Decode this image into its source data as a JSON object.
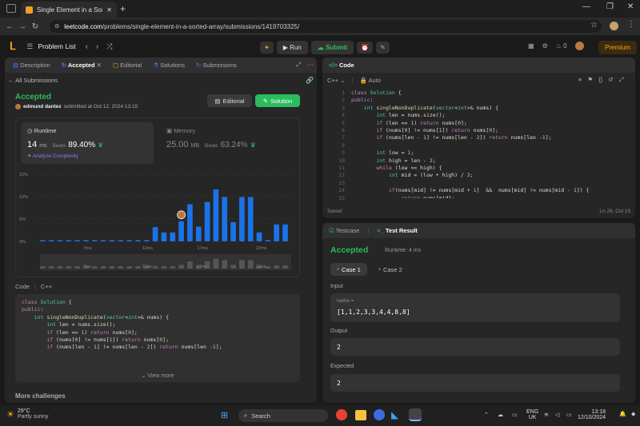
{
  "browser": {
    "tab_title": "Single Element in a Sorted Arra",
    "url_host": "leetcode.com",
    "url_path": "/problems/single-element-in-a-sorted-array/submissions/1419703325/"
  },
  "topbar": {
    "problem_list": "Problem List",
    "run": "Run",
    "submit": "Submit",
    "coins": "0",
    "premium": "Premium"
  },
  "left_tabs": [
    {
      "label": "Description"
    },
    {
      "label": "Accepted"
    },
    {
      "label": "Editorial"
    },
    {
      "label": "Solutions"
    },
    {
      "label": "Submissions"
    }
  ],
  "submission": {
    "back_label": "All Submissions",
    "status": "Accepted",
    "user": "edmund dantez",
    "submitted_text": "submitted at Oct 12, 2024 13:15",
    "editorial_btn": "Editorial",
    "solution_btn": "Solution",
    "runtime_label": "Runtime",
    "runtime_value": "14",
    "runtime_unit": "ms",
    "runtime_beats_label": "Beats",
    "runtime_beats": "89.40%",
    "analyze": "Analyze Complexity",
    "memory_label": "Memory",
    "memory_value": "25.00",
    "memory_unit": "MB",
    "memory_beats_label": "Beats",
    "memory_beats": "63.24%"
  },
  "chart_data": {
    "type": "bar",
    "y_ticks": [
      "15%",
      "10%",
      "5%",
      "0%"
    ],
    "x_ticks": [
      "7ms",
      "12ms",
      "17ms",
      "22ms"
    ],
    "ylim": [
      0,
      15
    ],
    "values": [
      0.3,
      0.3,
      0.3,
      0.3,
      0.3,
      0.3,
      0.3,
      0.3,
      0.3,
      0.3,
      0.3,
      0.3,
      0.3,
      3.2,
      2.0,
      2.0,
      4.5,
      8.3,
      3.3,
      8.8,
      11.6,
      9.9,
      4.3,
      9.9,
      9.9,
      2.0,
      0.3,
      3.8,
      3.8
    ],
    "highlight_index": 16,
    "grid": true
  },
  "code_section": {
    "code_label": "Code",
    "lang": "C++",
    "view_more": "View more",
    "lines": [
      "class Solution {",
      "public:",
      "    int singleNonDuplicate(vector<int>& nums) {",
      "        int len = nums.size();",
      "        if (len == 1) return nums[0];",
      "        if (nums[0] != nums[1]) return nums[0];",
      "        if (nums[len - 1] != nums[len - 2]) return nums[len -1];"
    ],
    "more_challenges": "More challenges"
  },
  "editor": {
    "title": "Code",
    "lang": "C++",
    "auto": "Auto",
    "saved": "Saved",
    "cursor": "Ln 26, Col 19",
    "lines": [
      "class Solution {",
      "public:",
      "    int singleNonDuplicate(vector<int>& nums) {",
      "        int len = nums.size();",
      "        if (len == 1) return nums[0];",
      "        if (nums[0] != nums[1]) return nums[0];",
      "        if (nums[len - 1] != nums[len - 2]) return nums[len -1];",
      "",
      "        int low = 1;",
      "        int high = len - 2;",
      "        while (low <= high) {",
      "            int mid = (low + high) / 2;",
      "",
      "            if(nums[mid] != nums[mid + 1]  &&  nums[mid] != nums[mid - 1]) {",
      "                return nums[mid];"
    ],
    "line_numbers": [
      "1",
      "2",
      "3",
      "4",
      "5",
      "6",
      "7",
      "8",
      "9",
      "10",
      "11",
      "12",
      "13",
      "14",
      "15"
    ]
  },
  "test": {
    "tab_testcase": "Testcase",
    "tab_result": "Test Result",
    "status": "Accepted",
    "runtime": "Runtime: 4 ms",
    "case1": "Case 1",
    "case2": "Case 2",
    "input_label": "Input",
    "input_name": "nums =",
    "input_value": "[1,1,2,3,3,4,4,8,8]",
    "output_label": "Output",
    "output_value": "2",
    "expected_label": "Expected",
    "expected_value": "2"
  },
  "taskbar": {
    "weather_temp": "29°C",
    "weather_desc": "Partly sunny",
    "search": "Search",
    "lang1": "ENG",
    "lang2": "UK",
    "time": "13:18",
    "date": "12/10/2024"
  },
  "colors": {
    "accent_green": "#2cbb5d",
    "bar_blue": "#1a73e8",
    "premium": "#ffa116"
  }
}
